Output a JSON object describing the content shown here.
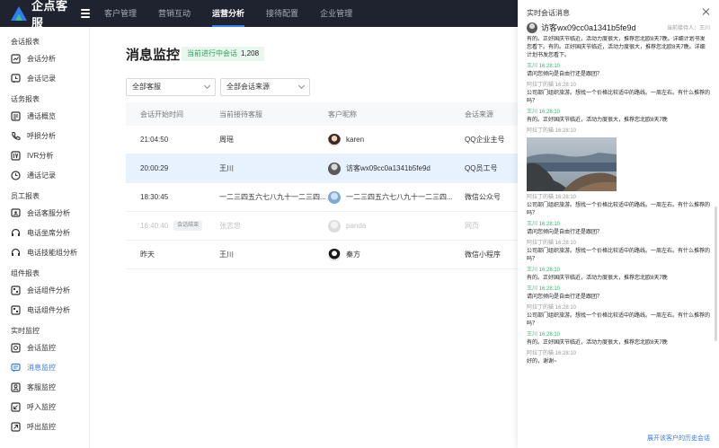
{
  "app": {
    "name": "企点客服"
  },
  "topnav": [
    "客户管理",
    "营销互动",
    "运营分析",
    "接待配置",
    "企业管理"
  ],
  "topnav_active": 2,
  "sidebar": {
    "groups": [
      {
        "title": "会话报表",
        "items": [
          {
            "label": "会话分析",
            "icon": "chart-icon"
          },
          {
            "label": "会话记录",
            "icon": "chat-history-icon"
          }
        ]
      },
      {
        "title": "话务报表",
        "items": [
          {
            "label": "通话概览",
            "icon": "overview-icon"
          },
          {
            "label": "呼损分析",
            "icon": "phone-icon"
          },
          {
            "label": "IVR分析",
            "icon": "ivr-icon"
          },
          {
            "label": "通话记录",
            "icon": "clock-icon"
          }
        ]
      },
      {
        "title": "员工报表",
        "items": [
          {
            "label": "会话客服分析",
            "icon": "agent-chat-icon"
          },
          {
            "label": "电话坐席分析",
            "icon": "headset-icon"
          },
          {
            "label": "电话技能组分析",
            "icon": "headset-icon"
          }
        ]
      },
      {
        "title": "组件报表",
        "items": [
          {
            "label": "会话组件分析",
            "icon": "widget-icon"
          },
          {
            "label": "电话组件分析",
            "icon": "widget-icon"
          }
        ]
      },
      {
        "title": "实时监控",
        "items": [
          {
            "label": "会话监控",
            "icon": "monitor-icon"
          },
          {
            "label": "消息监控",
            "icon": "message-icon"
          },
          {
            "label": "客服监控",
            "icon": "agent-icon"
          },
          {
            "label": "呼入监控",
            "icon": "call-in-icon"
          },
          {
            "label": "呼出监控",
            "icon": "call-out-icon"
          }
        ]
      }
    ],
    "active_label": "消息监控"
  },
  "main": {
    "title": "消息监控",
    "badge_label": "当前进行中会话",
    "badge_count": "1,208",
    "filter_agent": "全部客服",
    "filter_source": "全部会话来源",
    "columns": [
      "会话开始时间",
      "当前接待客服",
      "客户昵称",
      "会话来源"
    ],
    "rows": [
      {
        "time": "21:04:50",
        "agent": "周瑶",
        "customer": "karen",
        "source": "QQ企业主号",
        "tag": "",
        "state": "normal"
      },
      {
        "time": "20:00:29",
        "agent": "王川",
        "customer": "访客wx09cc0a1341b5fe9d",
        "source": "QQ员工号",
        "tag": "",
        "state": "selected"
      },
      {
        "time": "18:30:45",
        "agent": "一二三四五六七八九十一二三四...",
        "customer": "一二三四五六七八九十一二三四...",
        "source": "微信公众号",
        "tag": "",
        "state": "normal"
      },
      {
        "time": "16:40:40",
        "agent": "张志忠",
        "customer": "panda",
        "source": "网页",
        "tag": "会话结束",
        "state": "ended"
      },
      {
        "time": "昨天",
        "agent": "王川",
        "customer": "秦方",
        "source": "微信小程序",
        "tag": "",
        "state": "normal"
      }
    ]
  },
  "panel": {
    "title": "实时会话消息",
    "visitor": "访客wx09cc0a1341b5fe9d",
    "agent_label": "当前接待人：王川",
    "footer_link": "展开该客户的历史会话",
    "messages": [
      {
        "head": "",
        "who": "agent",
        "text": "有的。正好国庆节临近，活动力度很大，推荐您北欧8天7晚。详细计划书发您看下。有的。正好国庆节临近，活动力度很大，推荐您北欧8天7晚。详细计划书发您看下。"
      },
      {
        "head": "王川 16:28:10",
        "who": "agent",
        "text": "请问您倾向是自由行还是跟团？"
      },
      {
        "head": "阿拉丁的猫 16:28:10",
        "who": "customer",
        "text": "公司部门组织旅游。想找一个价格比较适中的路线。一周左右。有什么推荐的吗？"
      },
      {
        "head": "王川 16:28:10",
        "who": "agent",
        "text": "有的。正好国庆节临近，活动力度很大，推荐您北欧8天7晚"
      },
      {
        "head": "阿拉丁的猫 16:28:10",
        "who": "customer",
        "text": "",
        "image": true
      },
      {
        "head": "阿拉丁的猫 16:28:10",
        "who": "customer",
        "text": "公司部门组织旅游。想找一个价格比较适中的路线。一周左右。有什么推荐的吗？"
      },
      {
        "head": "王川 16:28:10",
        "who": "agent",
        "text": "请问您倾向是自由行还是跟团？"
      },
      {
        "head": "阿拉丁的猫 16:28:10",
        "who": "customer",
        "text": "公司部门组织旅游。想找一个价格比较适中的路线。一周左右。有什么推荐的吗？"
      },
      {
        "head": "王川 16:28:10",
        "who": "agent",
        "text": "有的。正好国庆节临近，活动力度很大，推荐您北欧8天7晚"
      },
      {
        "head": "王川 16:28:10",
        "who": "agent",
        "text": "请问您倾向是自由行还是跟团？"
      },
      {
        "head": "阿拉丁的猫 16:28:10",
        "who": "customer",
        "text": "公司部门组织旅游。想找一个价格比较适中的路线。一周左右。有什么推荐的吗？"
      },
      {
        "head": "王川 16:28:10",
        "who": "agent",
        "text": "有的。正好国庆节临近，活动力度很大，推荐您北欧8天7晚"
      },
      {
        "head": "阿拉丁的猫 16:28:10",
        "who": "customer",
        "text": "好的，谢谢~"
      }
    ]
  },
  "colors": {
    "accent": "#2f7cf6",
    "topbar": "#1f2330",
    "agent_name": "#3cb371"
  }
}
